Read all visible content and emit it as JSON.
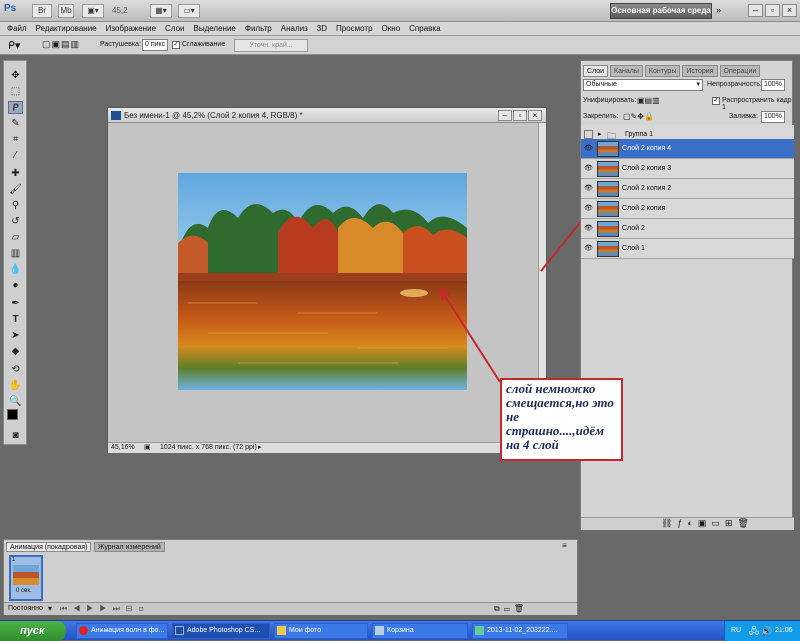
{
  "app": {
    "logo": "Ps",
    "zoom_value": "45,2",
    "workspace_button": "Основная рабочая среда"
  },
  "menu": [
    "Файл",
    "Редактирование",
    "Изображение",
    "Слои",
    "Выделение",
    "Фильтр",
    "Анализ",
    "3D",
    "Просмотр",
    "Окно",
    "Справка"
  ],
  "options": {
    "feather_label": "Растушевка:",
    "feather_value": "0 пикс",
    "antialias_label": "Сглаживание",
    "refine_edge": "Уточн. край..."
  },
  "document": {
    "title": "Без имени-1 @ 45,2% (Слой 2 копия 4, RGB/8) *",
    "zoom": "45,16%",
    "info": "1024 пикс. x 768 пикс. (72 ppi)"
  },
  "layers_panel": {
    "tabs": [
      "Слои",
      "Каналы",
      "Контуры",
      "История",
      "Операции"
    ],
    "blend_mode": "Обычные",
    "opacity_label": "Непрозрачность:",
    "opacity_value": "100%",
    "unify_label": "Унифицировать:",
    "propagate_label": "Распространить кадр 1",
    "lock_label": "Закрепить:",
    "fill_label": "Заливка:",
    "fill_value": "100%",
    "layers": [
      {
        "name": "Группа 1",
        "visible": false,
        "selected": false,
        "group": true
      },
      {
        "name": "Слой 2 копия 4",
        "visible": true,
        "selected": true,
        "group": false
      },
      {
        "name": "Слой 2 копия 3",
        "visible": true,
        "selected": false,
        "group": false
      },
      {
        "name": "Слой 2 копия 2",
        "visible": true,
        "selected": false,
        "group": false
      },
      {
        "name": "Слой 2 копия",
        "visible": true,
        "selected": false,
        "group": false
      },
      {
        "name": "Слой 2",
        "visible": true,
        "selected": false,
        "group": false
      },
      {
        "name": "Слой 1",
        "visible": true,
        "selected": false,
        "group": false
      }
    ]
  },
  "annotation": {
    "text": "слой немножко смещается,но это не страшно....,идём на 4 слой",
    "color": "#c3282b"
  },
  "animation_panel": {
    "tabs": [
      "Анимация (покадровая)",
      "Журнал измерений"
    ],
    "frame_number": "1",
    "frame_delay": "0 сек.",
    "loop": "Постоянно"
  },
  "taskbar": {
    "start": "пуск",
    "items": [
      "Анимация волн в фо...",
      "Adobe Photoshop CS...",
      "Мои фото",
      "Корзина",
      "2013-11-02_203222...."
    ],
    "lang": "RU",
    "time": "21:06"
  }
}
